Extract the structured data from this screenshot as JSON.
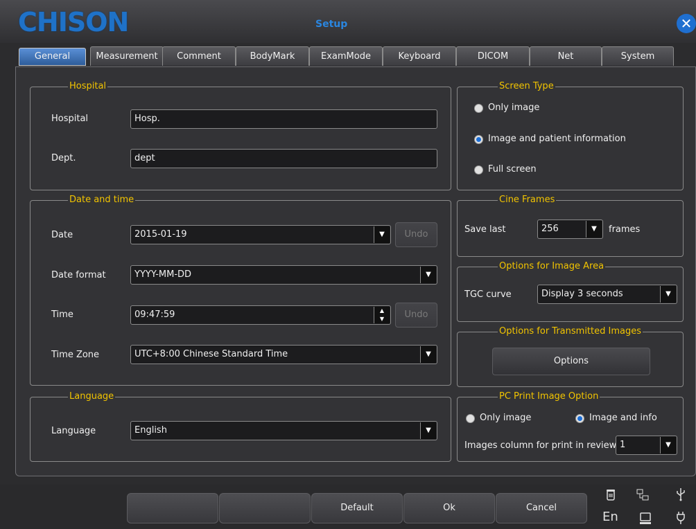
{
  "window": {
    "logo": "CHISON",
    "title": "Setup",
    "close_glyph": "✕"
  },
  "tabs": [
    {
      "label": "General",
      "active": true
    },
    {
      "label": "Measurement"
    },
    {
      "label": "Comment"
    },
    {
      "label": "BodyMark"
    },
    {
      "label": "ExamMode"
    },
    {
      "label": "Keyboard"
    },
    {
      "label": "DICOM"
    },
    {
      "label": "Net"
    },
    {
      "label": "System"
    }
  ],
  "hospital": {
    "group_title": "Hospital",
    "hospital_label": "Hospital",
    "hospital_value": "Hosp.",
    "dept_label": "Dept.",
    "dept_value": "dept"
  },
  "datetime": {
    "group_title": "Date and time",
    "date_label": "Date",
    "date_value": "2015-01-19",
    "undo_label": "Undo",
    "format_label": "Date format",
    "format_value": "YYYY-MM-DD",
    "time_label": "Time",
    "time_value": "09:47:59",
    "zone_label": "Time Zone",
    "zone_value": "UTC+8:00 Chinese Standard Time"
  },
  "language": {
    "group_title": "Language",
    "label": "Language",
    "value": "English"
  },
  "screen_type": {
    "group_title": "Screen Type",
    "options": [
      "Only image",
      "Image and patient information",
      "Full screen"
    ],
    "selected": "Image and patient information"
  },
  "cine": {
    "group_title": "Cine Frames",
    "save_label": "Save last",
    "value": "256",
    "unit": "frames"
  },
  "image_area": {
    "group_title": "Options for Image Area",
    "tgc_label": "TGC curve",
    "tgc_value": "Display 3 seconds"
  },
  "transmitted": {
    "group_title": "Options for Transmitted Images",
    "button_label": "Options"
  },
  "pc_print": {
    "group_title": "PC Print Image Option",
    "opt1": "Only image",
    "opt2": "Image and info",
    "selected": "Image and info",
    "column_label": "Images column for print in review",
    "column_value": "1"
  },
  "bottom": {
    "buttons": [
      "",
      "",
      "Default",
      "Ok",
      "Cancel"
    ],
    "status_text": "En"
  },
  "glyphs": {
    "dropdown": "▼",
    "up": "▲",
    "down": "▼"
  },
  "colors": {
    "accent": "#1f72c8",
    "group_title": "#f2c400",
    "active_tab": "#3a6fb5"
  }
}
